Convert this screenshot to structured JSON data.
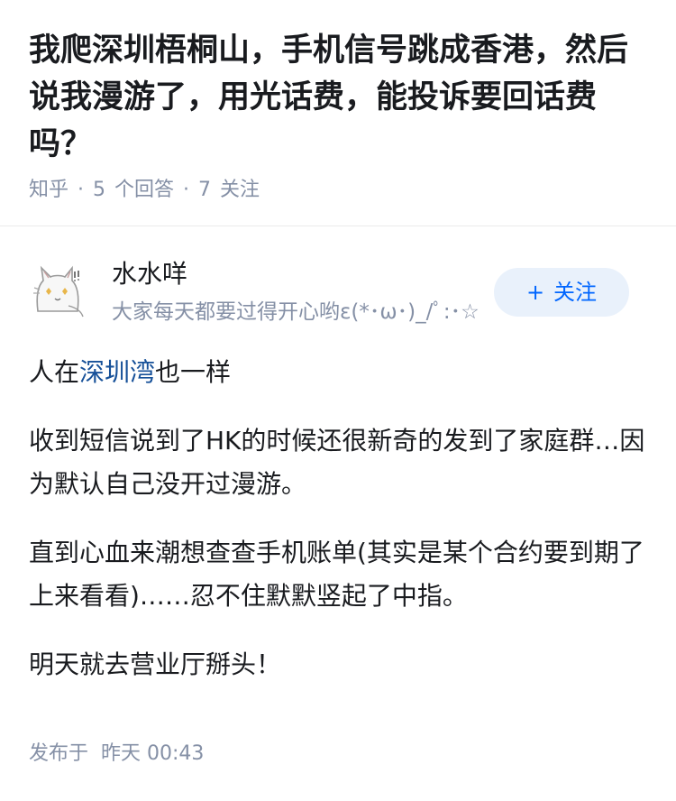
{
  "question": {
    "title": "我爬深圳梧桐山，手机信号跳成香港，然后说我漫游了，用光话费，能投诉要回话费吗？",
    "source": "知乎",
    "answer_count": "5",
    "answer_label": "个回答",
    "follower_count": "7",
    "follower_label": "关注"
  },
  "author": {
    "name": "水水咩",
    "bio": "大家每天都要过得开心哟ε(*･ω･)_/ﾟ:･☆",
    "follow_label": "关注",
    "follow_icon": "plus-icon",
    "avatar_icon": "cat-avatar-icon"
  },
  "answer": {
    "p1_prefix": "人在",
    "p1_link": "深圳湾",
    "p1_suffix": "也一样",
    "p2": "收到短信说到了HK的时候还很新奇的发到了家庭群…因为默认自己没开过漫游。",
    "p3": "直到心血来潮想查查手机账单(其实是某个合约要到期了上来看看)……忍不住默默竖起了中指。",
    "p4": "明天就去营业厅掰头！",
    "publish_label": "发布于",
    "publish_time": "昨天 00:43"
  },
  "colors": {
    "link": "#175199",
    "meta": "#8590a6",
    "follow_bg": "#e9f1fb",
    "follow_text": "#0066ff"
  }
}
